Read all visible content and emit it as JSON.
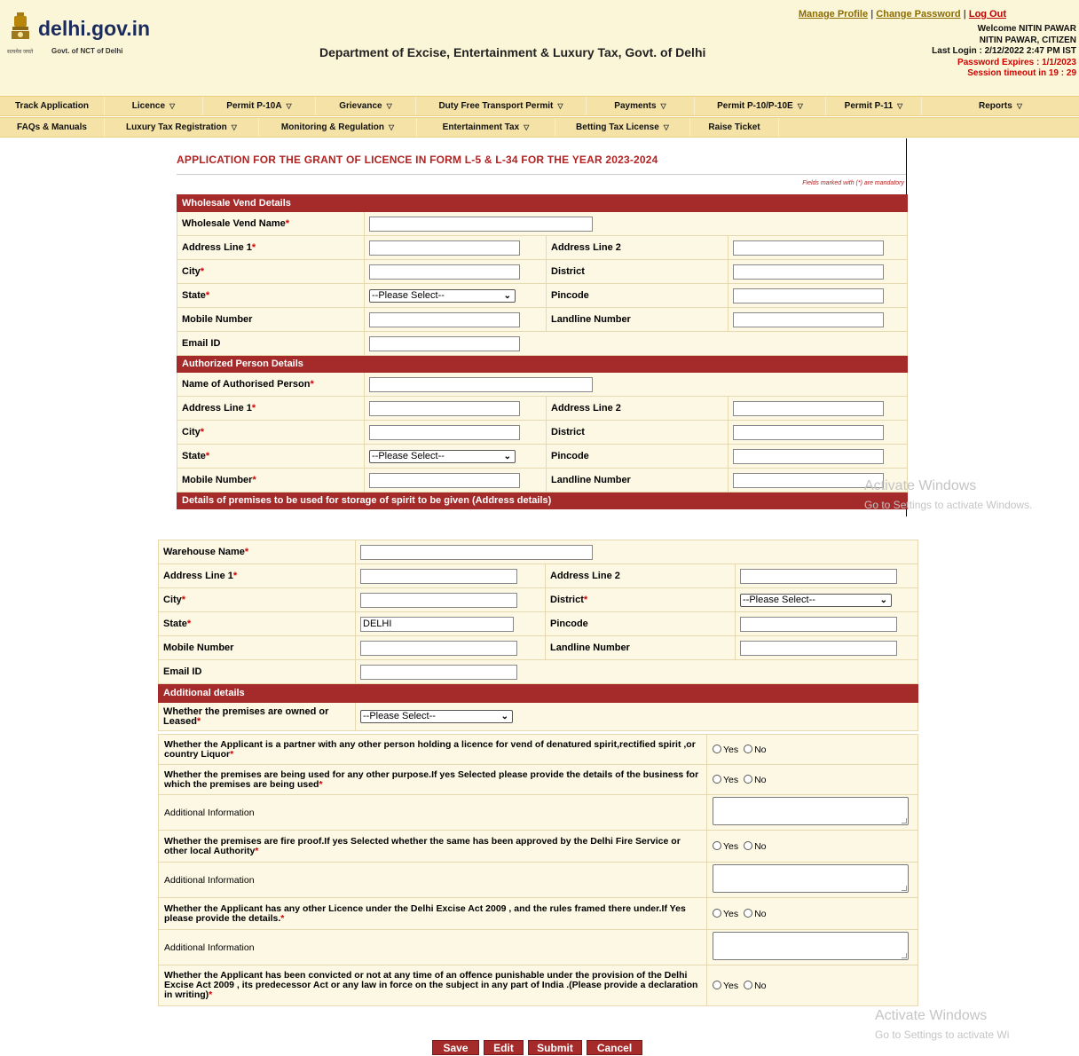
{
  "header": {
    "logo_text": "delhi.gov.in",
    "logo_tag_hindi": "सत्यमेव जयते",
    "logo_subtitle": "Govt. of NCT of Delhi",
    "department": "Department of Excise, Entertainment & Luxury Tax, Govt. of Delhi",
    "links": {
      "manage_profile": "Manage Profile",
      "sep1": "|",
      "change_password": "Change Password",
      "sep2": "|",
      "logout": "Log Out"
    },
    "welcome": "Welcome NITIN PAWAR",
    "user_role": "NITIN PAWAR, CITIZEN",
    "last_login": "Last Login : 2/12/2022 2:47 PM IST",
    "password_expires": "Password Expires : 1/1/2023",
    "session_timeout": "Session timeout in  19 : 29"
  },
  "menu_row1": [
    {
      "label": "Track Application",
      "dropdown": false
    },
    {
      "label": "Licence",
      "dropdown": true
    },
    {
      "label": "Permit P-10A",
      "dropdown": true
    },
    {
      "label": "Grievance",
      "dropdown": true
    },
    {
      "label": "Duty Free Transport Permit",
      "dropdown": true
    },
    {
      "label": "Payments",
      "dropdown": true
    },
    {
      "label": "Permit P-10/P-10E",
      "dropdown": true
    },
    {
      "label": "Permit P-11",
      "dropdown": true
    },
    {
      "label": "Reports",
      "dropdown": true
    }
  ],
  "menu_row2": [
    {
      "label": "FAQs & Manuals",
      "dropdown": false
    },
    {
      "label": "Luxury Tax Registration",
      "dropdown": true
    },
    {
      "label": "Monitoring & Regulation",
      "dropdown": true
    },
    {
      "label": "Entertainment Tax",
      "dropdown": true
    },
    {
      "label": "Betting Tax License",
      "dropdown": true
    },
    {
      "label": "Raise Ticket",
      "dropdown": false
    }
  ],
  "form": {
    "title": "APPLICATION FOR THE GRANT OF LICENCE IN FORM L-5 & L-34 FOR THE YEAR 2023-2024",
    "mandatory_note": "Fields marked with (*) are mandatory",
    "wholesale": {
      "heading": "Wholesale Vend Details",
      "vend_name": "Wholesale Vend Name",
      "address1": "Address Line 1",
      "address2": "Address Line 2",
      "city": "City",
      "district": "District",
      "state": "State",
      "state_value": "--Please Select--",
      "pincode": "Pincode",
      "mobile": "Mobile Number",
      "landline": "Landline Number",
      "email": "Email ID"
    },
    "authorized": {
      "heading": "Authorized Person Details",
      "name": "Name of Authorised Person",
      "address1": "Address Line 1",
      "address2": "Address Line 2",
      "city": "City",
      "district": "District",
      "state": "State",
      "state_value": "--Please Select--",
      "pincode": "Pincode",
      "mobile": "Mobile Number",
      "landline": "Landline Number"
    },
    "premises_heading": "Details of premises to be used for storage of spirit to be given (Address details)",
    "warehouse": {
      "name": "Warehouse Name",
      "address1": "Address Line 1",
      "address2": "Address Line 2",
      "city": "City",
      "district": "District",
      "district_value": "--Please Select--",
      "state": "State",
      "state_value": "DELHI",
      "pincode": "Pincode",
      "mobile": "Mobile Number",
      "landline": "Landline Number",
      "email": "Email ID"
    },
    "additional": {
      "heading": "Additional details",
      "owned_leased": "Whether the premises are owned or Leased",
      "owned_leased_value": "--Please Select--"
    },
    "questions": {
      "q1": "Whether the Applicant is a partner with any other person holding a licence for vend of denatured spirit,rectified spirit ,or country Liquor",
      "q2": "Whether the premises are being used for any other purpose.If yes Selected please provide the details of the business for which the premises are being used",
      "q3": "Whether the premises are fire proof.If yes Selected whether the same has been approved by the Delhi Fire Service or other local Authority",
      "q4": "Whether the Applicant has any other Licence under the Delhi Excise Act 2009 , and the rules framed there under.If Yes please provide the details.",
      "q5": "Whether the Applicant has been convicted or not at any time of an offence punishable under the provision of the Delhi Excise Act 2009 , its predecessor Act or any law in force on the subject in any part of India .(Please provide a declaration in writing)",
      "additional_info": "Additional Information",
      "yes": "Yes",
      "no": "No"
    },
    "required_mark": "*"
  },
  "buttons": {
    "save": "Save",
    "edit": "Edit",
    "submit": "Submit",
    "cancel": "Cancel"
  },
  "watermark": {
    "title": "Activate Windows",
    "line1": "Go to Settings to activate Windows.",
    "line2": "Go to Settings to activate Wi"
  }
}
